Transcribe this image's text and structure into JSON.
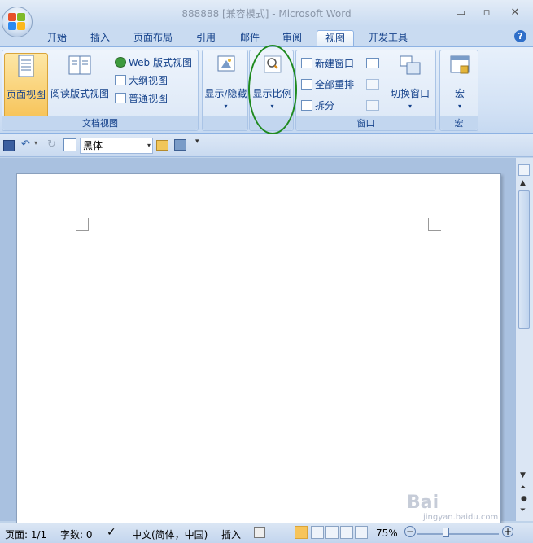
{
  "window": {
    "title": "888888 [兼容模式] - Microsoft Word",
    "min_glyph": "▭",
    "max_glyph": "▫",
    "close_glyph": "✕"
  },
  "tabs": [
    {
      "label": "开始"
    },
    {
      "label": "插入"
    },
    {
      "label": "页面布局"
    },
    {
      "label": "引用"
    },
    {
      "label": "邮件"
    },
    {
      "label": "审阅"
    },
    {
      "label": "视图",
      "active": true
    },
    {
      "label": "开发工具"
    }
  ],
  "help_glyph": "?",
  "ribbon": {
    "doc_views": {
      "label": "文档视图",
      "page_view": "页面视图",
      "reading_view": "阅读版式视图",
      "web_view": "Web 版式视图",
      "outline_view": "大纲视图",
      "draft_view": "普通视图"
    },
    "show_hide": {
      "label": "显示/隐藏"
    },
    "zoom": {
      "label": "显示比例"
    },
    "window": {
      "label": "窗口",
      "new_window": "新建窗口",
      "arrange_all": "全部重排",
      "split": "拆分",
      "switch_windows": "切换窗口"
    },
    "macros": {
      "label": "宏",
      "button": "宏"
    }
  },
  "qat": {
    "font_name": "黑体"
  },
  "status": {
    "page": "页面: 1/1",
    "words": "字数: 0",
    "language": "中文(简体，中国)",
    "insert_mode": "插入",
    "zoom": "75%"
  },
  "watermark": {
    "brand": "Bai",
    "sub": "jingyan.baidu.com"
  },
  "colors": {
    "accent": "#15428b",
    "active_view": "#f7c45a"
  }
}
